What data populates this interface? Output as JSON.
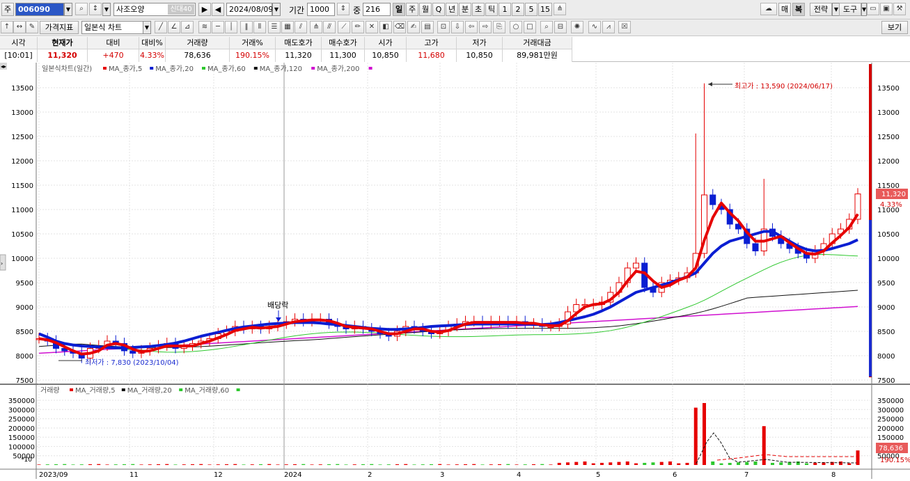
{
  "toolbar": {
    "code_prefix": "주",
    "stock_code": "006090",
    "stock_name": "사조오양",
    "credit_badge": "신대40",
    "date": "2024/08/09",
    "period_label": "기간",
    "period_value": "1000",
    "mid_label": "중",
    "mid_value": "216",
    "periods": [
      "일",
      "주",
      "월",
      "Q",
      "년",
      "분",
      "초",
      "틱",
      "1",
      "2",
      "5",
      "15"
    ],
    "active_period": "일",
    "right_buttons": [
      "매",
      "복",
      "전략",
      "도구"
    ],
    "indicator_button": "가격지표",
    "chart_type": "일본식 차트",
    "view_button": "보기"
  },
  "quote": {
    "headers": [
      "시각",
      "현재가",
      "대비",
      "대비%",
      "거래량",
      "거래%",
      "매도호가",
      "매수호가",
      "시가",
      "고가",
      "저가",
      "거래대금"
    ],
    "values": [
      "[10:01]",
      "11,320",
      "+470",
      "4.33%",
      "78,636",
      "190.15%",
      "11,320",
      "11,300",
      "10,850",
      "11,680",
      "10,850",
      "89,981만원"
    ]
  },
  "chart": {
    "legend_title": "일본식차트(일간)",
    "ma_legend": [
      {
        "label": "MA_종가,5",
        "color": "#e60000"
      },
      {
        "label": "MA_종가,20",
        "color": "#0a1ed2"
      },
      {
        "label": "MA_종가,60",
        "color": "#2ec82e"
      },
      {
        "label": "MA_종가,120",
        "color": "#111111"
      },
      {
        "label": "MA_종가,200",
        "color": "#d010d0"
      }
    ],
    "high_label": "최고가 : 13,590 (2024/06/17)",
    "low_label": "최저가 : 7,830 (2023/10/04)",
    "dividend_label": "배당락",
    "current_price": "11,320",
    "current_change": "4.33%",
    "price_ticks": [
      "13500",
      "13000",
      "12500",
      "12000",
      "11500",
      "11000",
      "10500",
      "10000",
      "9500",
      "9000",
      "8500",
      "8000",
      "7500"
    ],
    "volume_legend_title": "거래량",
    "volume_legend": [
      {
        "label": "MA_거래량,5",
        "color": "#e60000"
      },
      {
        "label": "MA_거래량,20",
        "color": "#111111"
      },
      {
        "label": "MA_거래량,60",
        "color": "#2ec82e"
      }
    ],
    "volume_ticks": [
      "350000",
      "300000",
      "250000",
      "200000",
      "150000",
      "100000",
      "50000"
    ],
    "volume_unit": "*10",
    "volume_current": "78,636",
    "volume_pct": "190.15%",
    "month_labels": [
      "2023/09",
      "11",
      "12",
      "2024",
      "2",
      "3",
      "4",
      "5",
      "6",
      "7",
      "8"
    ],
    "colors": {
      "up": "#e60000",
      "down": "#0a1ed2",
      "accent": "#2b57c6"
    }
  },
  "chart_data": {
    "type": "candlestick",
    "price_range": [
      7500,
      13900
    ],
    "annotations": [
      {
        "label": "최고가",
        "value": 13590,
        "date": "2024/06/17"
      },
      {
        "label": "최저가",
        "value": 7830,
        "date": "2023/10/04"
      }
    ],
    "last": {
      "open": 10850,
      "high": 11680,
      "low": 10850,
      "close": 11320,
      "volume": 78636
    },
    "close_series": [
      8350,
      8300,
      8150,
      8100,
      8050,
      7950,
      8150,
      8200,
      8300,
      8250,
      8100,
      8050,
      8100,
      8150,
      8200,
      8250,
      8150,
      8200,
      8250,
      8300,
      8350,
      8450,
      8500,
      8600,
      8550,
      8600,
      8550,
      8600,
      8650,
      8700,
      8750,
      8700,
      8750,
      8750,
      8650,
      8600,
      8550,
      8600,
      8550,
      8500,
      8450,
      8400,
      8500,
      8600,
      8550,
      8500,
      8450,
      8500,
      8600,
      8650,
      8700,
      8700,
      8650,
      8700,
      8700,
      8650,
      8700,
      8650,
      8650,
      8600,
      8600,
      8650,
      8900,
      9050,
      9050,
      9050,
      9100,
      9300,
      9500,
      9800,
      9900,
      9400,
      9300,
      9500,
      9550,
      9600,
      9700,
      10100,
      11300,
      11100,
      11000,
      10700,
      10600,
      10300,
      10150,
      10600,
      10450,
      10300,
      10200,
      10100,
      10000,
      10150,
      10300,
      10500,
      10600,
      10800,
      11320
    ],
    "ma20_series": [
      8450,
      8380,
      8300,
      8250,
      8220,
      8200,
      8190,
      8180,
      8170,
      8160,
      8160,
      8170,
      8180,
      8190,
      8210,
      8230,
      8260,
      8300,
      8350,
      8400,
      8440,
      8480,
      8520,
      8560,
      8590,
      8610,
      8630,
      8650,
      8660,
      8670,
      8680,
      8680,
      8680,
      8670,
      8650,
      8640,
      8620,
      8600,
      8580,
      8560,
      8550,
      8540,
      8540,
      8550,
      8560,
      8580,
      8600,
      8610,
      8620,
      8630,
      8640,
      8650,
      8650,
      8650,
      8650,
      8650,
      8650,
      8650,
      8640,
      8640,
      8650,
      8680,
      8720,
      8760,
      8800,
      8850,
      8920,
      9000,
      9100,
      9200,
      9300,
      9350,
      9400,
      9450,
      9500,
      9560,
      9620,
      9700,
      9900,
      10100,
      10250,
      10350,
      10400,
      10450,
      10500,
      10550,
      10550,
      10450,
      10350,
      10250,
      10180,
      10150,
      10160,
      10200,
      10250,
      10300,
      10380
    ]
  }
}
